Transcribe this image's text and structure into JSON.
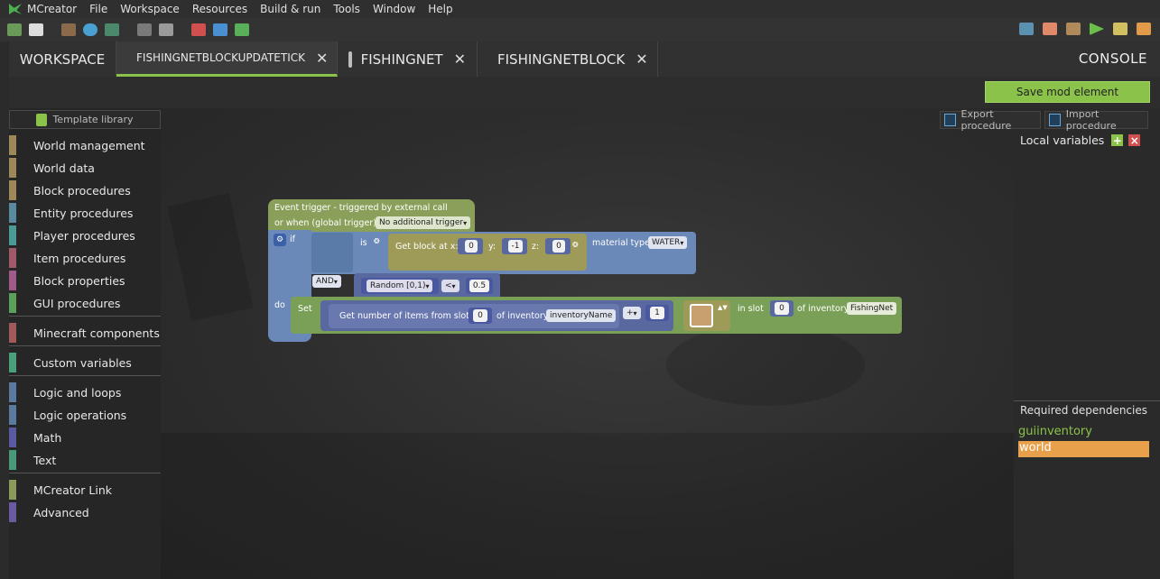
{
  "menu": [
    "MCreator",
    "File",
    "Workspace",
    "Resources",
    "Build & run",
    "Tools",
    "Window",
    "Help"
  ],
  "tabs": {
    "workspace": "WORKSPACE",
    "active": "FISHINGNETBLOCKUPDATETICK",
    "tab2": "FISHINGNET",
    "tab3": "FISHINGNETBLOCK",
    "console": "CONSOLE"
  },
  "actions": {
    "save": "Save mod element",
    "template_library": "Template library",
    "export": "Export procedure",
    "import": "Import procedure"
  },
  "palette": [
    {
      "label": "World management",
      "color": "#9e8758"
    },
    {
      "label": "World data",
      "color": "#9e8758"
    },
    {
      "label": "Block procedures",
      "color": "#9e8758"
    },
    {
      "label": "Entity procedures",
      "color": "#5a8aa0"
    },
    {
      "label": "Player procedures",
      "color": "#4a9a95"
    },
    {
      "label": "Item procedures",
      "color": "#a05a6a"
    },
    {
      "label": "Block properties",
      "color": "#a05a8a"
    },
    {
      "label": "GUI procedures",
      "color": "#5aa05a"
    },
    {
      "label": "Minecraft components",
      "color": "#a05a5a"
    },
    {
      "label": "Custom variables",
      "color": "#4aa07a"
    },
    {
      "label": "Logic and loops",
      "color": "#5a7aa0"
    },
    {
      "label": "Logic operations",
      "color": "#5a7aa0"
    },
    {
      "label": "Math",
      "color": "#5a5aa0"
    },
    {
      "label": "Text",
      "color": "#4a9a7a"
    },
    {
      "label": "MCreator Link",
      "color": "#8a9a5a"
    },
    {
      "label": "Advanced",
      "color": "#6a5aa0"
    }
  ],
  "right_panel": {
    "local_variables": "Local variables",
    "required_dependencies": "Required dependencies",
    "dependencies": [
      "guiinventory",
      "world"
    ]
  },
  "blocks": {
    "event_line1": "Event trigger - triggered by external call",
    "event_line2": "or when (global trigger):",
    "event_trigger": "No additional trigger",
    "if": "if",
    "is": "is",
    "get_block": "Get block at x:",
    "x": "0",
    "y_label": "y:",
    "y": "-1",
    "z_label": "z:",
    "z": "0",
    "material_type": "material type",
    "material": "WATER",
    "and": "AND",
    "random": "Random [0,1)",
    "compare": "<",
    "threshold": "0.5",
    "do": "do",
    "set": "Set",
    "get_items": "Get number of items from slot",
    "slot1": "0",
    "of_inventory": "of inventory",
    "inventory_name": "inventoryName",
    "plus": "+",
    "one": "1",
    "in_slot": "in slot",
    "slot2": "0",
    "of_inventory2": "of inventory",
    "fishing_net": "FishingNet"
  }
}
